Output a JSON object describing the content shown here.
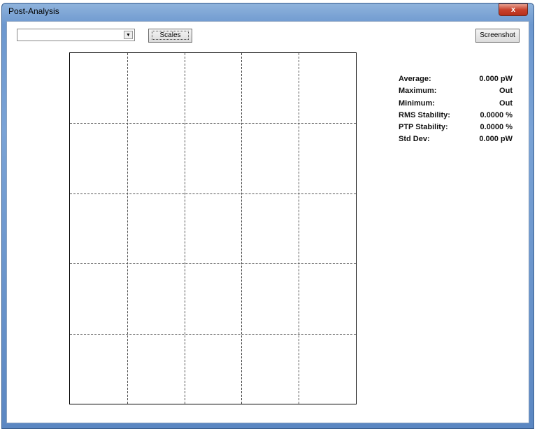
{
  "window": {
    "title": "Post-Analysis",
    "close": "x"
  },
  "toolbar": {
    "combo_value": "",
    "scales_label": "Scales",
    "screenshot_label": "Screenshot"
  },
  "stats": [
    {
      "label": "Average:",
      "value": "0.000 pW"
    },
    {
      "label": "Maximum:",
      "value": "Out"
    },
    {
      "label": "Minimum:",
      "value": "Out"
    },
    {
      "label": "RMS Stability:",
      "value": "0.0000 %"
    },
    {
      "label": "PTP Stability:",
      "value": "0.0000 %"
    },
    {
      "label": "Std Dev:",
      "value": "0.000 pW"
    }
  ]
}
